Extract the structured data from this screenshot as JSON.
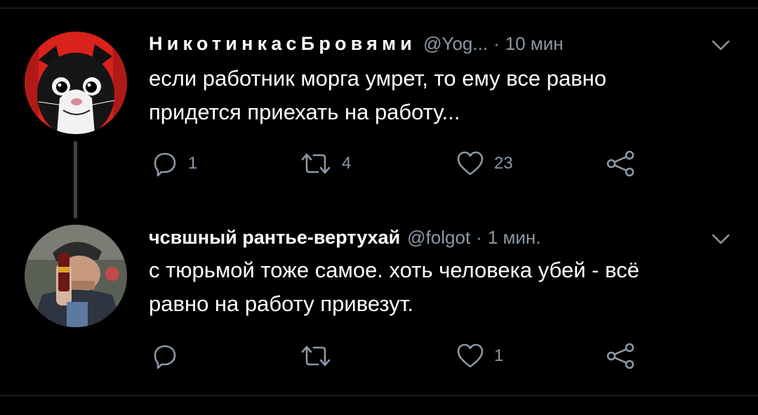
{
  "tweets": [
    {
      "name": "НикотинкасБровями",
      "handle": "@Yog...",
      "separator": "·",
      "time": "10 мин",
      "text": "если работник морга умрет, то ему все равно\nпридется приехать на работу...",
      "replies": "1",
      "retweets": "4",
      "likes": "23"
    },
    {
      "name": "чсвшный рантье-вертухай",
      "handle": "@folgot",
      "separator": "·",
      "time": "1 мин.",
      "text": "с тюрьмой тоже самое. хоть человека убей - всё\nравно на работу привезут.",
      "replies": "",
      "retweets": "",
      "likes": "1"
    }
  ],
  "icons": [
    "reply-icon",
    "retweet-icon",
    "like-icon",
    "share-icon",
    "chevron-down-icon"
  ],
  "colors": {
    "background": "#000000",
    "secondary_text": "#8b98a5",
    "divider": "#2f3336",
    "thread_line": "#3d4348",
    "avatar1_bg": "#d9221c"
  }
}
